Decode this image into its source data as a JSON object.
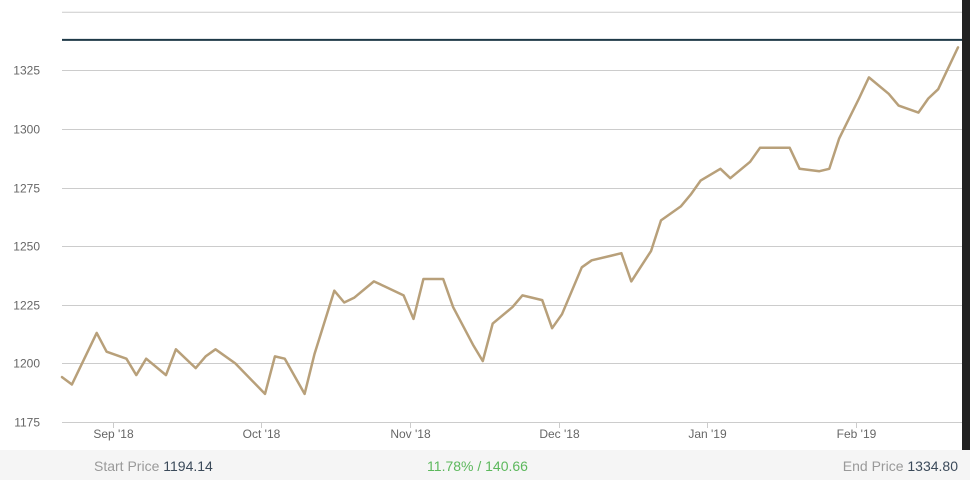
{
  "chart_data": {
    "type": "line",
    "title": "",
    "xlabel": "",
    "ylabel": "",
    "ylim": [
      1175,
      1350
    ],
    "yticks": [
      1175,
      1200,
      1225,
      1250,
      1275,
      1300,
      1325
    ],
    "xticks": [
      {
        "label": "Sep '18",
        "x": 10.3
      },
      {
        "label": "Oct '18",
        "x": 40.3
      },
      {
        "label": "Nov '18",
        "x": 70.3
      },
      {
        "label": "Dec '18",
        "x": 100.3
      },
      {
        "label": "Jan '19",
        "x": 130.3
      },
      {
        "label": "Feb '19",
        "x": 160.3
      }
    ],
    "reference_line": 1338,
    "grid": true,
    "series": [
      {
        "color": "#b8a07a",
        "points": [
          [
            0,
            1194.14
          ],
          [
            2,
            1191
          ],
          [
            7,
            1213
          ],
          [
            9,
            1205
          ],
          [
            13,
            1202
          ],
          [
            15,
            1195
          ],
          [
            17,
            1202
          ],
          [
            21,
            1195
          ],
          [
            23,
            1206
          ],
          [
            27,
            1198
          ],
          [
            29,
            1203
          ],
          [
            31,
            1206
          ],
          [
            35,
            1200
          ],
          [
            41,
            1187
          ],
          [
            43,
            1203
          ],
          [
            45,
            1202
          ],
          [
            49,
            1187
          ],
          [
            51,
            1204
          ],
          [
            55,
            1231
          ],
          [
            57,
            1226
          ],
          [
            59,
            1228
          ],
          [
            63,
            1235
          ],
          [
            65,
            1233
          ],
          [
            69,
            1229
          ],
          [
            71,
            1219
          ],
          [
            73,
            1236
          ],
          [
            77,
            1236
          ],
          [
            79,
            1224
          ],
          [
            83,
            1208
          ],
          [
            85,
            1201
          ],
          [
            87,
            1217
          ],
          [
            91,
            1224
          ],
          [
            93,
            1229
          ],
          [
            97,
            1227
          ],
          [
            99,
            1215
          ],
          [
            101,
            1221
          ],
          [
            105,
            1241
          ],
          [
            107,
            1244
          ],
          [
            111,
            1246
          ],
          [
            113,
            1247
          ],
          [
            115,
            1235
          ],
          [
            119,
            1248
          ],
          [
            121,
            1261
          ],
          [
            125,
            1267
          ],
          [
            127,
            1272
          ],
          [
            129,
            1278
          ],
          [
            133,
            1283
          ],
          [
            135,
            1279
          ],
          [
            139,
            1286
          ],
          [
            141,
            1292
          ],
          [
            145,
            1292
          ],
          [
            147,
            1292
          ],
          [
            149,
            1283
          ],
          [
            153,
            1282
          ],
          [
            155,
            1283
          ],
          [
            157,
            1296
          ],
          [
            161,
            1313
          ],
          [
            163,
            1322
          ],
          [
            167,
            1315
          ],
          [
            169,
            1310
          ],
          [
            173,
            1307
          ],
          [
            175,
            1313
          ],
          [
            177,
            1317
          ],
          [
            181,
            1334.8
          ]
        ]
      }
    ]
  },
  "footer": {
    "start_label": "Start Price",
    "start_value": "1194.14",
    "change": "11.78% / 140.66",
    "end_label": "End Price",
    "end_value": "1334.80"
  },
  "colors": {
    "line": "#b8a07a",
    "reference": "#1f3a48",
    "positive": "#5cb85c"
  }
}
